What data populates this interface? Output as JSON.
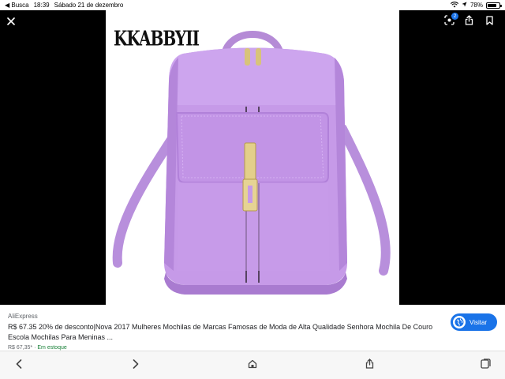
{
  "status_bar": {
    "back_app": "◀ Busca",
    "time": "18:39",
    "date": "Sábado 21 de dezembro",
    "battery": "78%",
    "battery_level": 0.78
  },
  "viewer": {
    "brand_logo": "KKABBYII",
    "lens_badge_count": "2"
  },
  "info": {
    "source": "AliExpress",
    "title": "R$ 67.35 20% de desconto|Nova 2017 Mulheres Mochilas de Marcas Famosas de Moda de Alta Qualidade Senhora Mochila De Couro Escola Mochilas Para Meninas ...",
    "price": "R$ 67,35*",
    "separator": "·",
    "stock": "Em estoque",
    "visit_label": "Visitar"
  },
  "colors": {
    "accent": "#1a73e8",
    "bag_purple": "#c69ae8",
    "stock_green": "#188038"
  },
  "icons": {
    "close": "close-icon",
    "lens": "google-lens-icon",
    "share": "share-icon",
    "bookmark": "bookmark-icon",
    "back": "chevron-left-icon",
    "forward": "chevron-right-icon",
    "home": "home-icon",
    "tabs": "tabs-icon",
    "globe": "globe-icon"
  }
}
